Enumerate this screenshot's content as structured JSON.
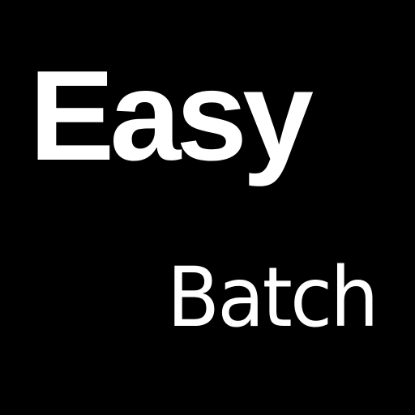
{
  "logo": {
    "primary_word": "Easy",
    "secondary_word": "Batch"
  },
  "colors": {
    "background": "#000000",
    "text": "#ffffff"
  }
}
